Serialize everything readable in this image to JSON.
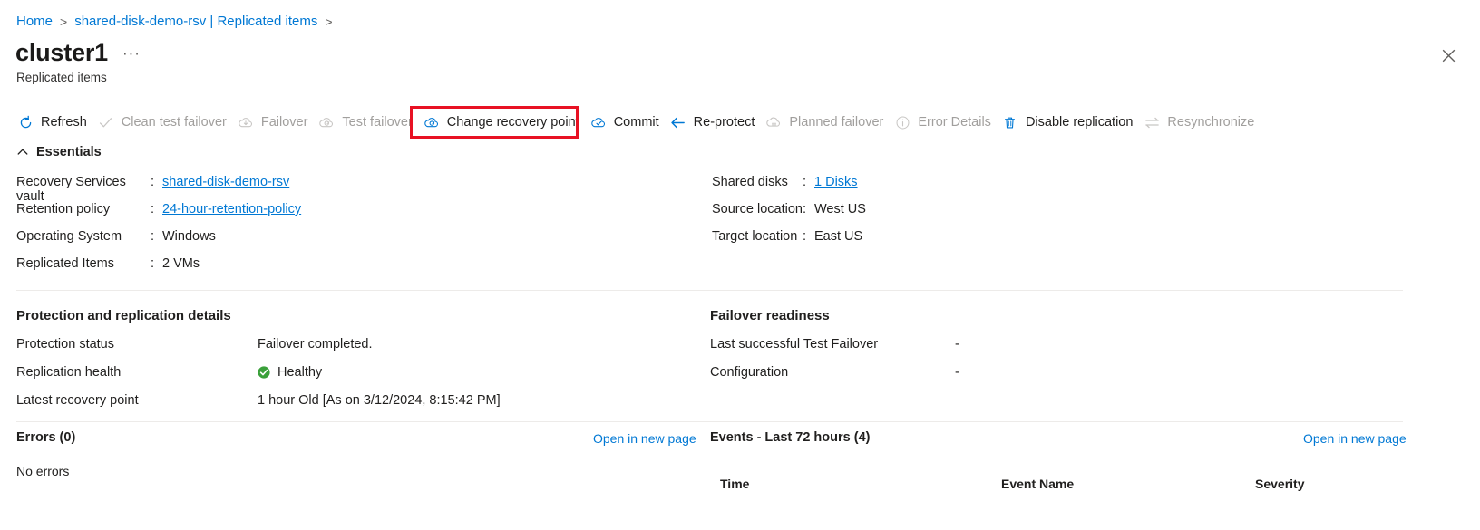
{
  "breadcrumb": {
    "items": [
      {
        "label": "Home",
        "link": true
      },
      {
        "label": "shared-disk-demo-rsv | Replicated items",
        "link": true
      }
    ],
    "separator": ">"
  },
  "header": {
    "title": "cluster1",
    "ellipsis": "···",
    "subtitle": "Replicated items",
    "close_icon": "close-icon"
  },
  "commandbar": {
    "items": [
      {
        "label": "Refresh",
        "icon": "refresh-icon",
        "disabled": false
      },
      {
        "label": "Clean test failover",
        "icon": "checkmark-icon",
        "disabled": true
      },
      {
        "label": "Failover",
        "icon": "cloud-download-icon",
        "disabled": true
      },
      {
        "label": "Test failover",
        "icon": "cloud-refresh-icon",
        "disabled": true
      },
      {
        "label": "Change recovery point",
        "icon": "cloud-refresh-icon",
        "disabled": false
      },
      {
        "label": "Commit",
        "icon": "cloud-checkmark-icon",
        "disabled": false
      },
      {
        "label": "Re-protect",
        "icon": "arrow-left-icon",
        "disabled": false
      },
      {
        "label": "Planned failover",
        "icon": "cloud-planned-icon",
        "disabled": true
      },
      {
        "label": "Error Details",
        "icon": "info-circle-icon",
        "disabled": true
      },
      {
        "label": "Disable replication",
        "icon": "trash-icon",
        "disabled": false
      },
      {
        "label": "Resynchronize",
        "icon": "sync-arrows-icon",
        "disabled": true
      }
    ],
    "highlight_color": "#e81123",
    "highlighted_item": "Change recovery point"
  },
  "essentials": {
    "title": "Essentials",
    "collapse_icon": "chevron-up-icon",
    "left": [
      {
        "key": "Recovery Services vault",
        "colon": ":",
        "value": "shared-disk-demo-rsv",
        "link": true
      },
      {
        "key": "Retention policy",
        "colon": ":",
        "value": "24-hour-retention-policy",
        "link": true
      },
      {
        "key": "Operating System",
        "colon": ":",
        "value": "Windows",
        "link": false
      },
      {
        "key": "Replicated Items",
        "colon": ":",
        "value": "2 VMs",
        "link": false
      }
    ],
    "right": [
      {
        "key": "Shared disks",
        "colon": ":",
        "value": "1 Disks",
        "link": true
      },
      {
        "key": "Source location",
        "colon": ":",
        "value": "West US",
        "link": false
      },
      {
        "key": "Target location",
        "colon": ":",
        "value": "East US",
        "link": false
      }
    ]
  },
  "protection": {
    "title": "Protection and replication details",
    "rows": [
      {
        "key": "Protection status",
        "value": "Failover completed.",
        "status": null
      },
      {
        "key": "Replication health",
        "value": "Healthy",
        "status": "healthy"
      },
      {
        "key": "Latest recovery point",
        "value": "1 hour Old [As on 3/12/2024, 8:15:42 PM]",
        "status": null
      }
    ],
    "healthy_color": "#3aa03a"
  },
  "readiness": {
    "title": "Failover readiness",
    "rows": [
      {
        "key": "Last successful Test Failover",
        "value": "-"
      },
      {
        "key": "Configuration",
        "value": "-"
      }
    ]
  },
  "errors_panel": {
    "title": "Errors (0)",
    "open_link": "Open in new page",
    "empty_text": "No errors"
  },
  "events_panel": {
    "title": "Events - Last 72 hours (4)",
    "open_link": "Open in new page",
    "columns": [
      "Time",
      "Event Name",
      "Severity"
    ],
    "rows": []
  },
  "colors": {
    "accent": "#0078d4",
    "text": "#201f1e",
    "muted": "#a19f9d",
    "divider": "#edebe9",
    "highlight": "#e81123",
    "healthy": "#3aa03a"
  }
}
